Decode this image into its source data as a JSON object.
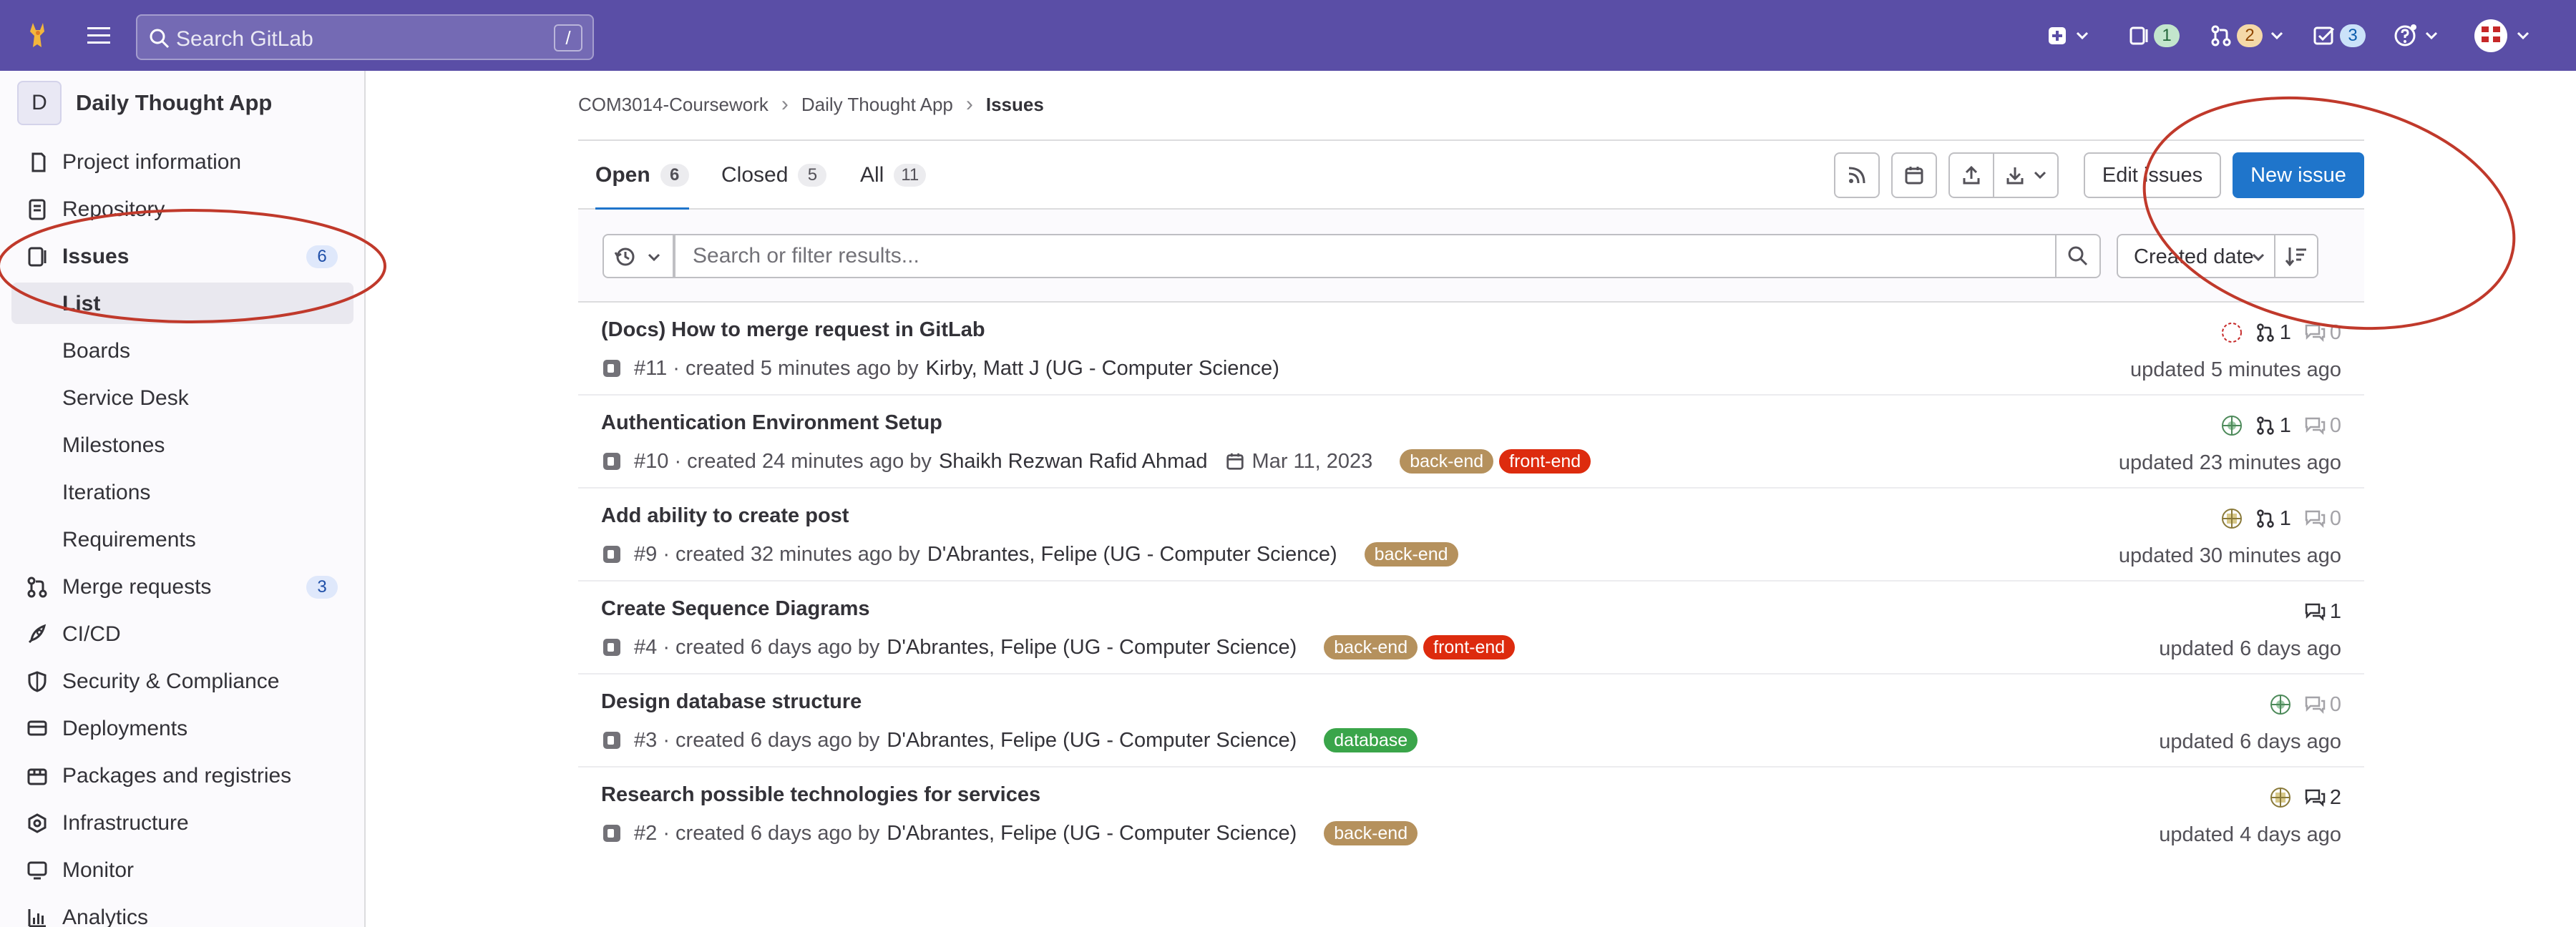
{
  "topbar": {
    "search_placeholder": "Search GitLab",
    "search_shortcut": "/",
    "issues_count": "1",
    "mr_count": "2",
    "todos_count": "3"
  },
  "sidebar": {
    "project_initial": "D",
    "project_name": "Daily Thought App",
    "items": [
      {
        "label": "Project information"
      },
      {
        "label": "Repository"
      },
      {
        "label": "Issues",
        "count": "6"
      },
      {
        "label": "List"
      },
      {
        "label": "Boards"
      },
      {
        "label": "Service Desk"
      },
      {
        "label": "Milestones"
      },
      {
        "label": "Iterations"
      },
      {
        "label": "Requirements"
      },
      {
        "label": "Merge requests",
        "count": "3"
      },
      {
        "label": "CI/CD"
      },
      {
        "label": "Security & Compliance"
      },
      {
        "label": "Deployments"
      },
      {
        "label": "Packages and registries"
      },
      {
        "label": "Infrastructure"
      },
      {
        "label": "Monitor"
      },
      {
        "label": "Analytics"
      }
    ]
  },
  "breadcrumb": [
    "COM3014-Coursework",
    "Daily Thought App",
    "Issues"
  ],
  "tabs": [
    {
      "label": "Open",
      "count": "6"
    },
    {
      "label": "Closed",
      "count": "5"
    },
    {
      "label": "All",
      "count": "11"
    }
  ],
  "actions": {
    "edit_issues": "Edit issues",
    "new_issue": "New issue"
  },
  "filter": {
    "placeholder": "Search or filter results...",
    "sort_label": "Created date"
  },
  "issues": [
    {
      "title": "(Docs) How to merge request in GitLab",
      "ref": "#11",
      "created": "· created 5 minutes ago by",
      "author": "Kirby, Matt J (UG - Computer Science)",
      "due": "",
      "labels": [],
      "mrs": "1",
      "comments": "0",
      "updated": "updated 5 minutes ago"
    },
    {
      "title": "Authentication Environment Setup",
      "ref": "#10",
      "created": "· created 24 minutes ago by",
      "author": "Shaikh Rezwan Rafid Ahmad",
      "due": "Mar 11, 2023",
      "labels": [
        "back-end",
        "front-end"
      ],
      "mrs": "1",
      "comments": "0",
      "updated": "updated 23 minutes ago"
    },
    {
      "title": "Add ability to create post",
      "ref": "#9",
      "created": "· created 32 minutes ago by",
      "author": "D'Abrantes, Felipe (UG - Computer Science)",
      "due": "",
      "labels": [
        "back-end"
      ],
      "mrs": "1",
      "comments": "0",
      "updated": "updated 30 minutes ago"
    },
    {
      "title": "Create Sequence Diagrams",
      "ref": "#4",
      "created": "· created 6 days ago by",
      "author": "D'Abrantes, Felipe (UG - Computer Science)",
      "due": "",
      "labels": [
        "back-end",
        "front-end"
      ],
      "mrs": "",
      "comments": "1",
      "updated": "updated 6 days ago"
    },
    {
      "title": "Design database structure",
      "ref": "#3",
      "created": "· created 6 days ago by",
      "author": "D'Abrantes, Felipe (UG - Computer Science)",
      "due": "",
      "labels": [
        "database"
      ],
      "mrs": "",
      "comments": "0",
      "updated": "updated 6 days ago"
    },
    {
      "title": "Research possible technologies for services",
      "ref": "#2",
      "created": "· created 6 days ago by",
      "author": "D'Abrantes, Felipe (UG - Computer Science)",
      "due": "",
      "labels": [
        "back-end"
      ],
      "mrs": "",
      "comments": "2",
      "updated": "updated 4 days ago"
    }
  ],
  "colors": {
    "topbar": "#5a4ea6",
    "primary": "#1f75cb",
    "label_back_end": "#b5915d",
    "label_front_end": "#dd2b0e",
    "label_database": "#3aa54a",
    "annotation": "#c0392b"
  }
}
